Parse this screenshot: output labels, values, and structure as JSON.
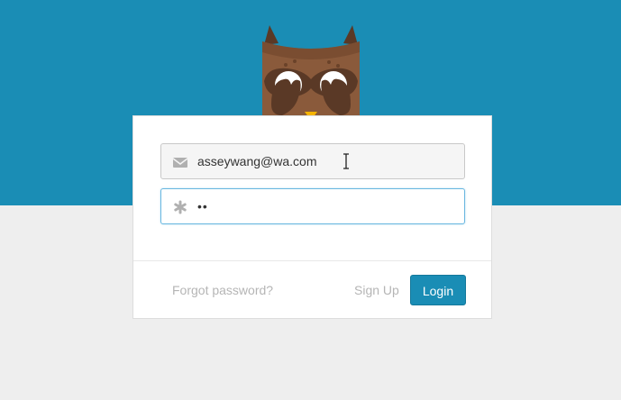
{
  "form": {
    "email_value": "asseywang@wa.com",
    "password_value": "••",
    "forgot_label": "Forgot password?",
    "signup_label": "Sign Up",
    "login_label": "Login"
  },
  "icons": {
    "email": "envelope-icon",
    "password": "asterisk-icon",
    "mascot": "owl-mascot"
  },
  "colors": {
    "header_bg": "#1a8db5",
    "page_bg": "#eeeeee",
    "primary_button": "#1a8db5",
    "muted_link": "#b5b5b5"
  }
}
